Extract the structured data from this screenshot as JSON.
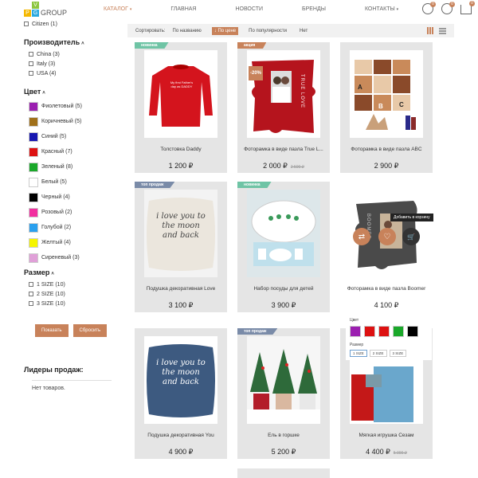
{
  "header": {
    "logo_letters": [
      "V",
      "Р",
      "G"
    ],
    "logo_text": "GROUP",
    "nav": [
      "Каталог",
      "Главная",
      "Новости",
      "Бренды",
      "Контакты"
    ],
    "compare_count": "0",
    "favorites_count": "0",
    "cart_count": "0"
  },
  "sidebar": {
    "country_top": "Citizen (1)",
    "manufacturer_title": "Производитель",
    "manufacturers": [
      "China (3)",
      "Italy (3)",
      "USA (4)"
    ],
    "color_title": "Цвет",
    "colors": [
      {
        "label": "Фиолетовый (5)",
        "hex": "#9b1fb0"
      },
      {
        "label": "Коричневый (5)",
        "hex": "#a0701a"
      },
      {
        "label": "Синий (5)",
        "hex": "#1717b0"
      },
      {
        "label": "Красный (7)",
        "hex": "#dd1111"
      },
      {
        "label": "Зеленый (8)",
        "hex": "#1aa82a"
      },
      {
        "label": "Белый (5)",
        "hex": "#ffffff"
      },
      {
        "label": "Черный (4)",
        "hex": "#000000"
      },
      {
        "label": "Розовый (2)",
        "hex": "#f22fa0"
      },
      {
        "label": "Голубой (2)",
        "hex": "#2aa0ee"
      },
      {
        "label": "Желтый (4)",
        "hex": "#f5f500"
      },
      {
        "label": "Сиреневый (3)",
        "hex": "#e0a0d8"
      }
    ],
    "size_title": "Размер",
    "sizes": [
      "1 SIZE (10)",
      "2 SIZE (10)",
      "3 SIZE (10)"
    ],
    "show_button": "Показать",
    "reset_button": "Сбросить",
    "leaders_title": "Лидеры продаж:",
    "leaders_empty": "Нет товаров."
  },
  "sort": {
    "label": "Сортировать:",
    "options": [
      "По названию",
      "По цене",
      "По популярности",
      "Нет"
    ],
    "active_index": 1
  },
  "products": [
    {
      "name": "Толстовка Daddy",
      "price": "1 200 ₽",
      "old_price": "",
      "ribbon": "новинка"
    },
    {
      "name": "Фоторамка в виде пазла True L...",
      "price": "2 000 ₽",
      "old_price": "2 500 ₽",
      "ribbon": "акция",
      "discount": "-20%"
    },
    {
      "name": "Фоторамка в виде пазла ABC",
      "price": "2 900 ₽",
      "old_price": "",
      "ribbon": ""
    },
    {
      "name": "Подушка декоративная Love",
      "price": "3 100 ₽",
      "old_price": "",
      "ribbon": "топ продаж"
    },
    {
      "name": "Набор посуды для детей",
      "price": "3 900 ₽",
      "old_price": "",
      "ribbon": "новинка"
    },
    {
      "name": "Фоторамка в виде пазла Boomer",
      "price": "4 100 ₽",
      "old_price": "",
      "ribbon": ""
    },
    {
      "name": "Подушка декоративная You",
      "price": "4 900 ₽",
      "old_price": "",
      "ribbon": ""
    },
    {
      "name": "Ель в горшке",
      "price": "5 200 ₽",
      "old_price": "",
      "ribbon": "топ продаж"
    },
    {
      "name": "Мягкая игрушка Сезам",
      "price": "4 400 ₽",
      "old_price": "5 000 ₽",
      "ribbon": ""
    }
  ],
  "hover_popup": {
    "tooltip": "Добавить в корзину",
    "color_label": "Цвет",
    "colors": [
      "#9b1fb0",
      "#dd1111",
      "#dd1111",
      "#1aa82a",
      "#000000"
    ],
    "size_label": "Размер",
    "sizes": [
      "1 SIZE",
      "2 SIZE",
      "3 SIZE"
    ]
  },
  "product_texts": {
    "sweatshirt": "My first Father's day as DADDY",
    "pillow_love": "i love you to the moon and back",
    "pillow_you": "i love you to the moon and back",
    "frame_true_love": "TRUE LOVE",
    "frame_boomer": "BOOMER",
    "abc_letters": [
      "A",
      "B",
      "C"
    ]
  }
}
